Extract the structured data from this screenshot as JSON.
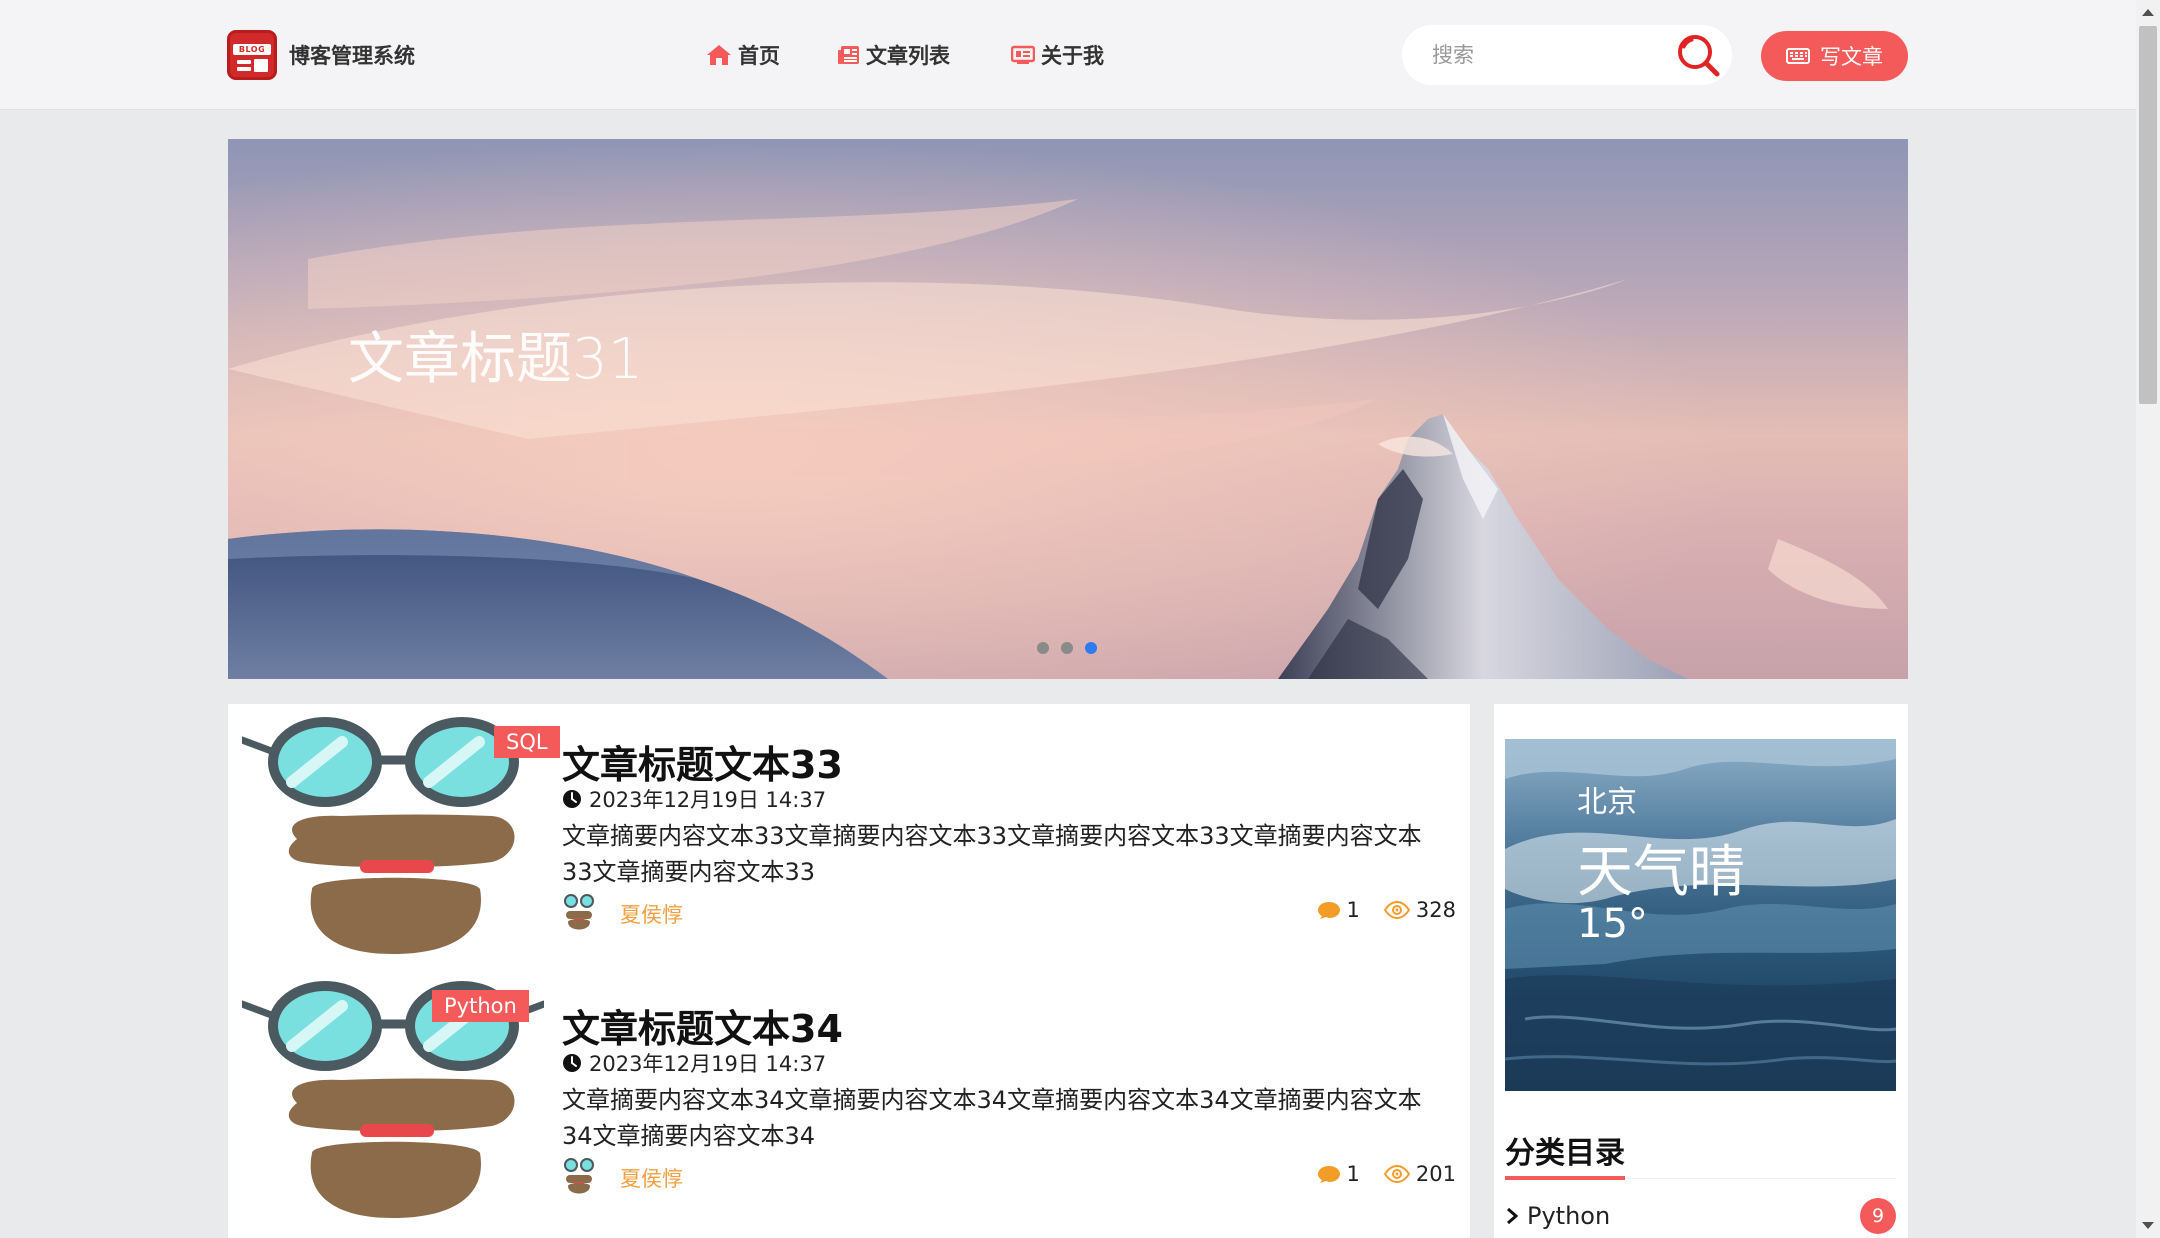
{
  "header": {
    "logo_badge": "BLOG",
    "site_name": "博客管理系统",
    "nav": [
      {
        "label": "首页",
        "icon": "home-icon"
      },
      {
        "label": "文章列表",
        "icon": "newspaper-icon"
      },
      {
        "label": "关于我",
        "icon": "id-card-icon"
      }
    ],
    "search_placeholder": "搜索",
    "write_button": "写文章"
  },
  "banner": {
    "title": "文章标题31",
    "slide_count": 3,
    "active_slide": 3
  },
  "articles": [
    {
      "tag": "SQL",
      "title": "文章标题文本33",
      "date": "2023年12月19日 14:37",
      "summary": "文章摘要内容文本33文章摘要内容文本33文章摘要内容文本33文章摘要内容文本33文章摘要内容文本33",
      "author": "夏侯惇",
      "comments": "1",
      "views": "328"
    },
    {
      "tag": "Python",
      "title": "文章标题文本34",
      "date": "2023年12月19日 14:37",
      "summary": "文章摘要内容文本34文章摘要内容文本34文章摘要内容文本34文章摘要内容文本34文章摘要内容文本34",
      "author": "夏侯惇",
      "comments": "1",
      "views": "201"
    }
  ],
  "sidebar": {
    "weather": {
      "city": "北京",
      "condition": "天气晴",
      "temperature": "15°"
    },
    "categories_title": "分类目录",
    "categories": [
      {
        "name": "Python",
        "count": "9"
      }
    ]
  },
  "colors": {
    "accent": "#f45a5a",
    "author": "#f0a042",
    "active_dot": "#2f7bf0"
  }
}
